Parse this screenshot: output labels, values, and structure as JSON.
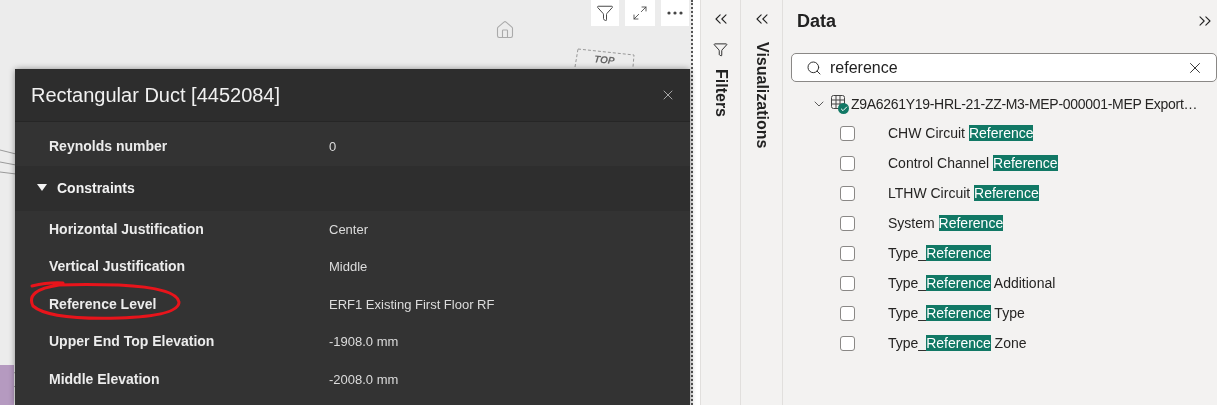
{
  "viewer": {
    "view_cube": {
      "top_label": "TOP"
    }
  },
  "properties_panel": {
    "title": "Rectangular Duct [4452084]",
    "rows": [
      {
        "kind": "property",
        "label": "Reynolds number",
        "value": "0"
      },
      {
        "kind": "section",
        "label": "Constraints",
        "expanded": true
      },
      {
        "kind": "property",
        "label": "Horizontal Justification",
        "value": "Center"
      },
      {
        "kind": "property",
        "label": "Vertical Justification",
        "value": "Middle"
      },
      {
        "kind": "property",
        "label": "Reference Level",
        "value": "ERF1 Existing First Floor RF",
        "annotated": true
      },
      {
        "kind": "property",
        "label": "Upper End Top Elevation",
        "value": "-1908.0 mm"
      },
      {
        "kind": "property",
        "label": "Middle Elevation",
        "value": "-2008.0 mm"
      }
    ]
  },
  "filters_pane": {
    "label": "Filters"
  },
  "visualizations_pane": {
    "label": "Visualizations"
  },
  "data_pane": {
    "title": "Data",
    "search": {
      "value": "reference"
    },
    "table": {
      "name": "Z9A6261Y19-HRL-21-ZZ-M3-MEP-000001-MEP Export…",
      "expanded": true,
      "fields": [
        {
          "before": "CHW Circuit ",
          "match": "Reference",
          "checked": false
        },
        {
          "before": "Control Channel ",
          "match": "Reference",
          "checked": false
        },
        {
          "before": "LTHW Circuit ",
          "match": "Reference",
          "checked": false
        },
        {
          "before": "System ",
          "match": "Reference",
          "checked": false
        },
        {
          "before": "Type_",
          "match": "Reference",
          "checked": false
        },
        {
          "before": "Type_",
          "match": "Reference",
          "after": " Additional",
          "checked": false
        },
        {
          "before": "Type_",
          "match": "Reference",
          "after": " Type",
          "checked": false
        },
        {
          "before": "Type_",
          "match": "Reference",
          "after": " Zone",
          "checked": false
        }
      ]
    }
  }
}
